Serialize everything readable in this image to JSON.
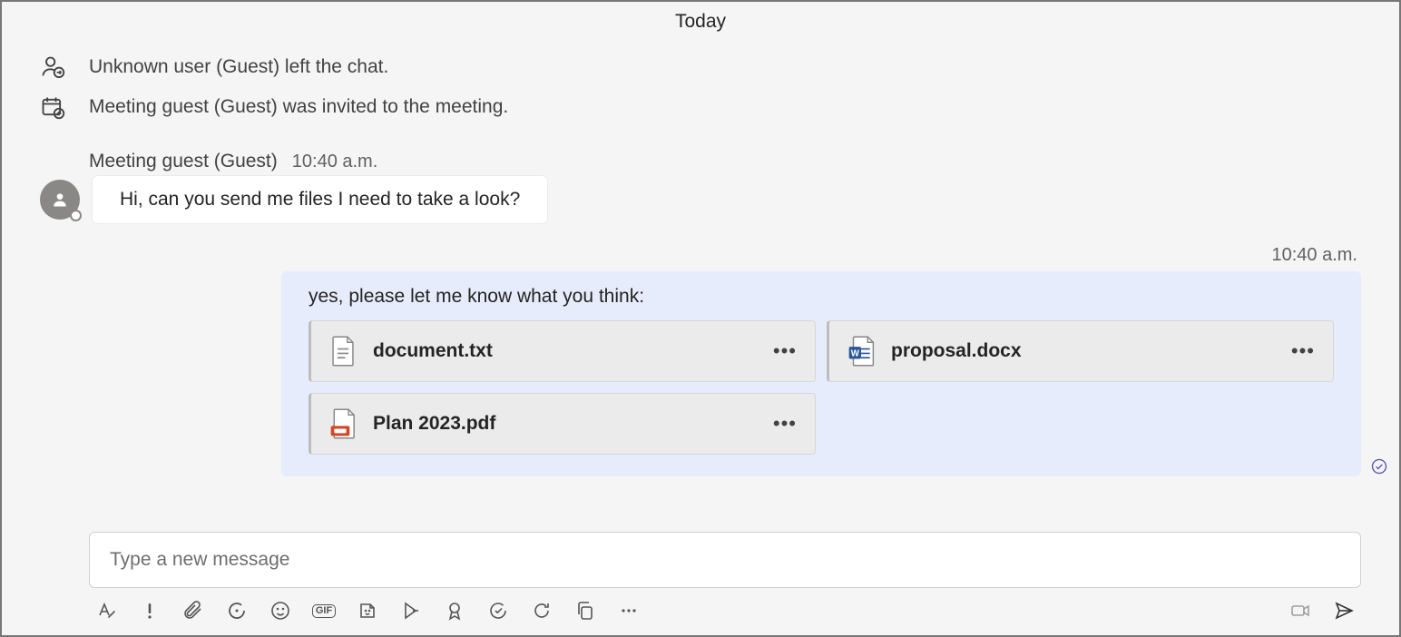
{
  "dateDivider": "Today",
  "systemEvents": [
    {
      "icon": "person-leave",
      "text": "Unknown user (Guest) left the chat."
    },
    {
      "icon": "calendar-add",
      "text": "Meeting guest (Guest) was invited to the meeting."
    }
  ],
  "incoming": {
    "sender": "Meeting guest (Guest)",
    "time": "10:40 a.m.",
    "text": "Hi, can you send me files I need to take a look?"
  },
  "outgoing": {
    "time": "10:40 a.m.",
    "text": "yes, please let me know what you think:",
    "attachments": [
      {
        "type": "txt",
        "name": "document.txt"
      },
      {
        "type": "docx",
        "name": "proposal.docx"
      },
      {
        "type": "pdf",
        "name": "Plan 2023.pdf"
      }
    ]
  },
  "composer": {
    "placeholder": "Type a new message"
  }
}
